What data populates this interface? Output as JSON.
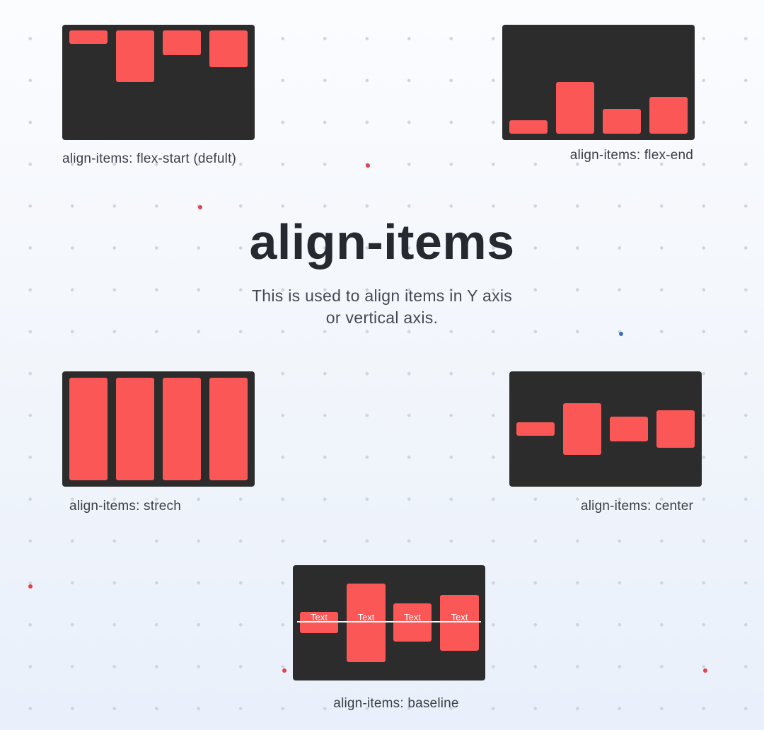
{
  "title": "align-items",
  "description": {
    "line1": "This is used to align items in Y axis",
    "line2": "or vertical axis."
  },
  "examples": {
    "flex_start": {
      "caption": "align-items: flex-start (defult)"
    },
    "flex_end": {
      "caption": "align-items: flex-end"
    },
    "stretch": {
      "caption": "align-items: strech"
    },
    "center": {
      "caption": "align-items: center"
    },
    "baseline": {
      "caption": "align-items: baseline",
      "item_labels": [
        "Text",
        "Text",
        "Text",
        "Text"
      ]
    }
  },
  "colors": {
    "panel": "#2c2c2c",
    "item": "#fb5757",
    "accent_red": "#e0424b",
    "accent_blue": "#3f6fb6"
  }
}
